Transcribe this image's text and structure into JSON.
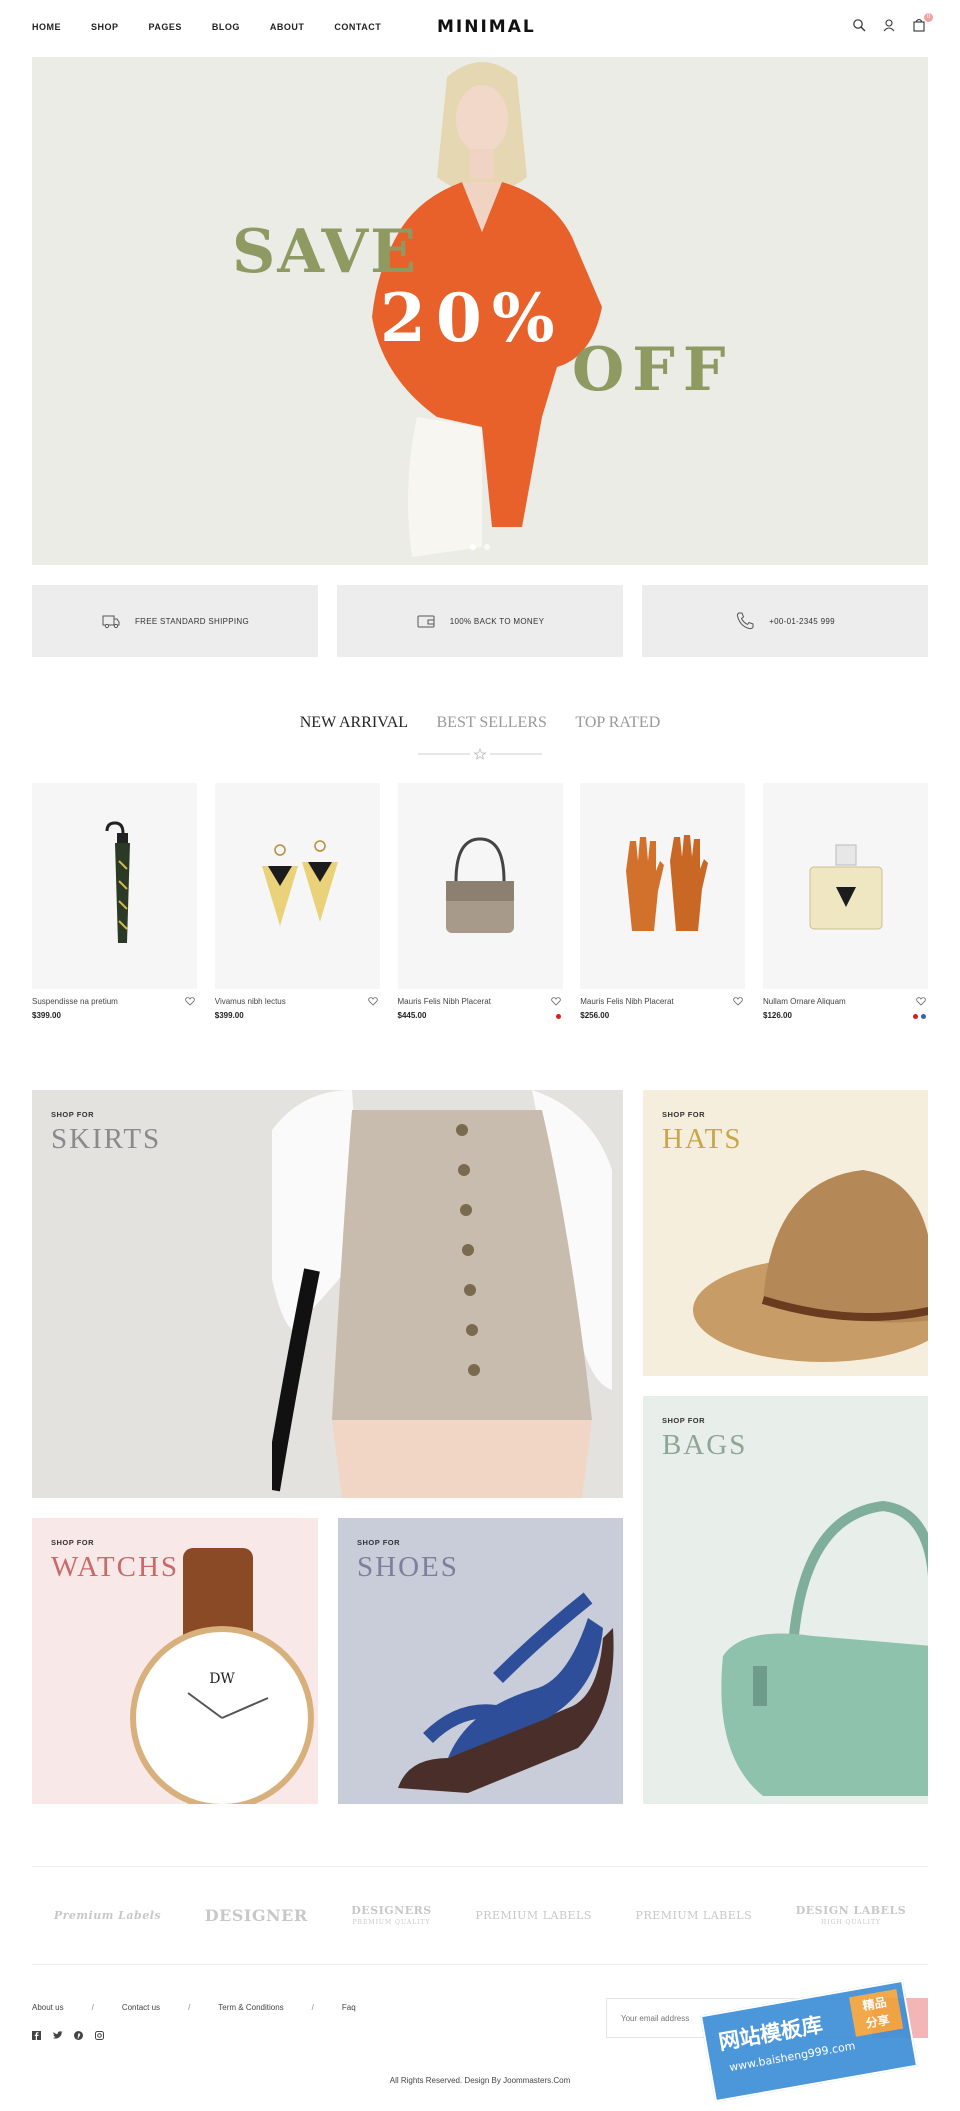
{
  "header": {
    "nav": [
      "HOME",
      "SHOP",
      "PAGES",
      "BLOG",
      "ABOUT",
      "CONTACT"
    ],
    "logo": "MINIMAL",
    "icons": [
      "search-icon",
      "user-icon",
      "cart-icon"
    ],
    "cart_count": "0"
  },
  "hero": {
    "line1": "SAVE",
    "line2": "20%",
    "line3": "OFF",
    "slides": 2,
    "accent_color": "#8f9a62",
    "shirt_color": "#e8602a"
  },
  "features": [
    {
      "label": "FREE STANDARD SHIPPING",
      "icon": "delivery-truck-icon"
    },
    {
      "label": "100% BACK TO MONEY",
      "icon": "wallet-icon"
    },
    {
      "label": "+00-01-2345 999",
      "icon": "phone-icon"
    }
  ],
  "tabs": {
    "items": [
      "NEW ARRIVAL",
      "BEST SELLERS",
      "TOP RATED"
    ],
    "active": 0
  },
  "products": [
    {
      "name": "Suspendisse na pretium",
      "price": "$399.00",
      "swatches": []
    },
    {
      "name": "Vivamus nibh lectus",
      "price": "$399.00",
      "swatches": []
    },
    {
      "name": "Mauris Felis Nibh Placerat",
      "price": "$445.00",
      "swatches": [
        "#d81e1e"
      ]
    },
    {
      "name": "Mauris Felis Nibh Placerat",
      "price": "$256.00",
      "swatches": []
    },
    {
      "name": "Nullam Ornare Aliquam",
      "price": "$126.00",
      "swatches": [
        "#d81e1e",
        "#3a5fb8"
      ]
    }
  ],
  "categories": {
    "shop_for": "SHOP FOR",
    "skirts": {
      "title": "SKIRTS",
      "color": "#8a8a8a"
    },
    "hats": {
      "title": "HATS",
      "color": "#c8a64a"
    },
    "bags": {
      "title": "BAGS",
      "color": "#8fa596"
    },
    "watchs": {
      "title": "WATCHS",
      "color": "#c96a6a"
    },
    "shoes": {
      "title": "SHOES",
      "color": "#7d7f9b"
    }
  },
  "brands": [
    {
      "main": "Premium Labels",
      "sub": ""
    },
    {
      "main": "DESIGNER",
      "sub": ""
    },
    {
      "main": "DESIGNERS",
      "sub": "PREMIUM QUALITY"
    },
    {
      "main": "PREMIUM LABELS",
      "sub": ""
    },
    {
      "main": "PREMIUM LABELS",
      "sub": ""
    },
    {
      "main": "DESIGN LABELS",
      "sub": "HIGH QUALITY"
    }
  ],
  "footer": {
    "links": [
      "About us",
      "Contact us",
      "Term & Conditions",
      "Faq"
    ],
    "separator": "/",
    "social": [
      "facebook-icon",
      "twitter-icon",
      "pinterest-icon",
      "instagram-icon"
    ],
    "email_placeholder": "Your email address",
    "copyright": "All Rights Reserved. Design By Joommasters.Com"
  },
  "watermark": {
    "line1": "网站模板库",
    "line2": "www.baisheng999.com",
    "badge1": "精品",
    "badge2": "分享"
  }
}
